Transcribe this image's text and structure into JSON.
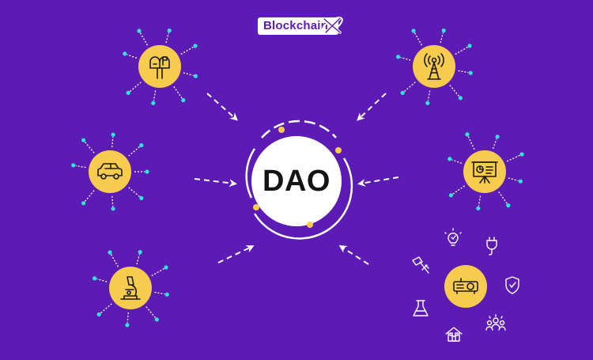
{
  "brand": {
    "name": "Blockchain",
    "mark_icon": "x-orbit-logo-icon",
    "colors": {
      "background": "#5b1bb4",
      "node": "#f7cb4d",
      "dot": "#2ee6d6",
      "white": "#ffffff",
      "ink": "#141414"
    }
  },
  "hub": {
    "label": "DAO"
  },
  "nodes": [
    {
      "id": "mailbox",
      "icon": "mailbox-icon"
    },
    {
      "id": "car",
      "icon": "car-icon"
    },
    {
      "id": "microscope",
      "icon": "microscope-icon"
    },
    {
      "id": "tower",
      "icon": "signal-tower-icon"
    },
    {
      "id": "presentation",
      "icon": "presentation-board-icon"
    },
    {
      "id": "projector",
      "icon": "projector-icon"
    }
  ],
  "satellite_icons": [
    "lightbulb-icon",
    "plug-icon",
    "hammer-icon",
    "shield-check-icon",
    "flask-icon",
    "team-icon",
    "house-icon"
  ]
}
